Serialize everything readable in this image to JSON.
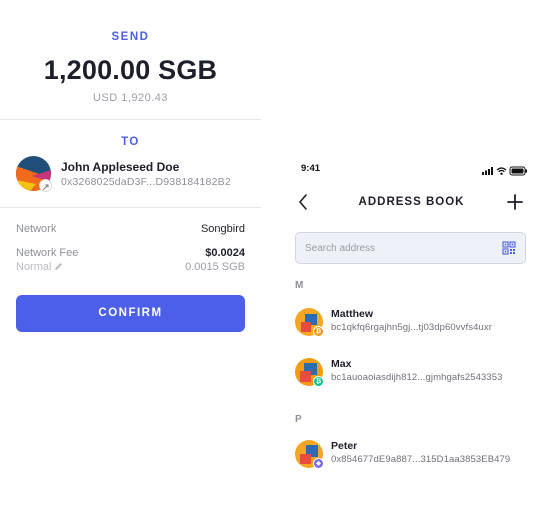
{
  "send": {
    "label": "SEND",
    "amount": "1,200.00 SGB",
    "usd_value": "USD 1,920.43",
    "to_label": "TO",
    "recipient": {
      "name": "John Appleseed Doe",
      "address": "0x3268025daD3F...D938184182B2"
    },
    "network_label": "Network",
    "network_value": "Songbird",
    "fee_label": "Network Fee",
    "fee_value": "$0.0024",
    "fee_speed": "Normal",
    "fee_token_value": "0.0015 SGB",
    "confirm_label": "CONFIRM",
    "accent_color": "#4b5fe8"
  },
  "address_book": {
    "status_time": "9:41",
    "title": "ADDRESS BOOK",
    "search_placeholder": "Search address",
    "sections": [
      {
        "letter": "M",
        "contacts": [
          {
            "name": "Matthew",
            "address": "bc1qkfq6rgajhn5gj...tj03dp60vvfs4uxr",
            "coin_icon": "bitcoin-icon",
            "coin_color": "#f7931a"
          },
          {
            "name": "Max",
            "address": "bc1auoaoiasdijh812...gjmhgafs2543353",
            "coin_icon": "bitcoin-cash-icon",
            "coin_color": "#0ac18e"
          }
        ]
      },
      {
        "letter": "P",
        "contacts": [
          {
            "name": "Peter",
            "address": "0x854677dE9a887...315D1aa3853EB479",
            "coin_icon": "ethereum-icon",
            "coin_color": "#7b68ee"
          }
        ]
      }
    ]
  }
}
